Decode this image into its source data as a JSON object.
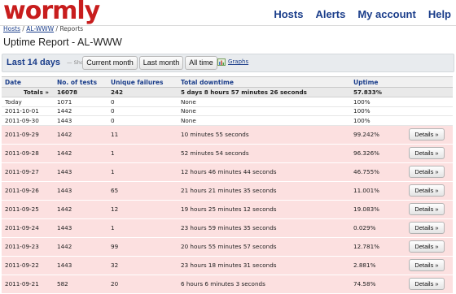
{
  "header": {
    "logo": "wormly",
    "nav": [
      "Hosts",
      "Alerts",
      "My account",
      "Help"
    ]
  },
  "breadcrumb": {
    "hosts": "Hosts",
    "host": "AL-WWW",
    "current": "Reports"
  },
  "page_title": "Uptime Report - AL-WWW",
  "filter": {
    "title": "Last 14 days",
    "show_label": "— Show:",
    "buttons": [
      "Current month",
      "Last month",
      "All time"
    ],
    "graphs_link": "Graphs"
  },
  "table": {
    "columns": [
      "Date",
      "No. of tests",
      "Unique failures",
      "Total downtime",
      "Uptime"
    ],
    "totals": {
      "label": "Totals »",
      "tests": "16078",
      "failures": "242",
      "downtime": "5 days 8 hours 57 minutes 26 seconds",
      "uptime": "57.833%"
    },
    "details_label": "Details »",
    "rows": [
      {
        "date": "Today",
        "tests": "1071",
        "failures": "0",
        "downtime": "None",
        "uptime": "100%",
        "status": "ok"
      },
      {
        "date": "2011-10-01",
        "tests": "1442",
        "failures": "0",
        "downtime": "None",
        "uptime": "100%",
        "status": "ok"
      },
      {
        "date": "2011-09-30",
        "tests": "1443",
        "failures": "0",
        "downtime": "None",
        "uptime": "100%",
        "status": "ok"
      },
      {
        "date": "2011-09-29",
        "tests": "1442",
        "failures": "11",
        "downtime": "10 minutes 55 seconds",
        "uptime": "99.242%",
        "status": "bad"
      },
      {
        "date": "2011-09-28",
        "tests": "1442",
        "failures": "1",
        "downtime": "52 minutes 54 seconds",
        "uptime": "96.326%",
        "status": "bad"
      },
      {
        "date": "2011-09-27",
        "tests": "1443",
        "failures": "1",
        "downtime": "12 hours 46 minutes 44 seconds",
        "uptime": "46.755%",
        "status": "bad"
      },
      {
        "date": "2011-09-26",
        "tests": "1443",
        "failures": "65",
        "downtime": "21 hours 21 minutes 35 seconds",
        "uptime": "11.001%",
        "status": "bad"
      },
      {
        "date": "2011-09-25",
        "tests": "1442",
        "failures": "12",
        "downtime": "19 hours 25 minutes 12 seconds",
        "uptime": "19.083%",
        "status": "bad"
      },
      {
        "date": "2011-09-24",
        "tests": "1443",
        "failures": "1",
        "downtime": "23 hours 59 minutes 35 seconds",
        "uptime": "0.029%",
        "status": "bad"
      },
      {
        "date": "2011-09-23",
        "tests": "1442",
        "failures": "99",
        "downtime": "20 hours 55 minutes 57 seconds",
        "uptime": "12.781%",
        "status": "bad"
      },
      {
        "date": "2011-09-22",
        "tests": "1443",
        "failures": "32",
        "downtime": "23 hours 18 minutes 31 seconds",
        "uptime": "2.881%",
        "status": "bad"
      },
      {
        "date": "2011-09-21",
        "tests": "582",
        "failures": "20",
        "downtime": "6 hours 6 minutes 3 seconds",
        "uptime": "74.58%",
        "status": "bad"
      }
    ]
  }
}
